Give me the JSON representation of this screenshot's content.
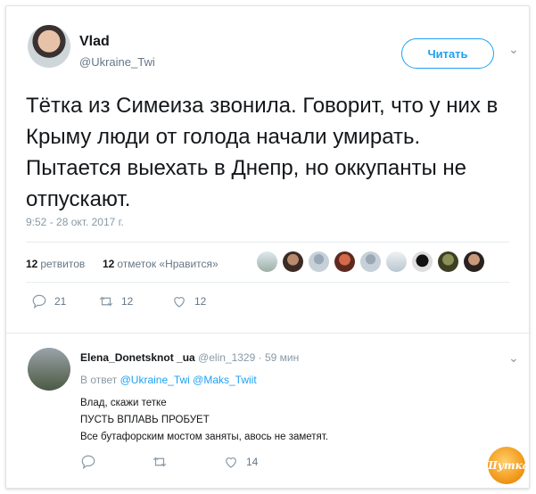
{
  "tweet": {
    "author_name": "Vlad",
    "author_handle": "@Ukraine_Twi",
    "follow_label": "Читать",
    "text": "Тётка из Симеиза звонила. Говорит, что у них в Крыму люди от голода начали умирать. Пытается выехать в Днепр, но оккупанты не отпускают.",
    "timestamp": "9:52 - 28 окт. 2017 г.",
    "retweets_count": "12",
    "retweets_label": "ретвитов",
    "likes_count": "12",
    "likes_label": "отметок «Нравится»",
    "actions": {
      "reply": "21",
      "retweet": "12",
      "like": "12"
    }
  },
  "reply": {
    "author_name": "Elena_Donetsknot _ua",
    "author_handle": "@elin_1329",
    "time": "· 59 мин",
    "reply_prefix": "В ответ",
    "reply_to": "@Ukraine_Twi @Maks_Twiit",
    "lines": [
      "Влад, скажи тетке",
      "ПУСТЬ ВПЛАВЬ ПРОБУЕТ",
      "Все бутафорским мостом заняты, авось не заметят."
    ],
    "actions": {
      "like": "14"
    }
  },
  "watermark": "Шутка",
  "colors": {
    "accent": "#1da1f2",
    "text": "#14171a",
    "muted": "#657786"
  }
}
